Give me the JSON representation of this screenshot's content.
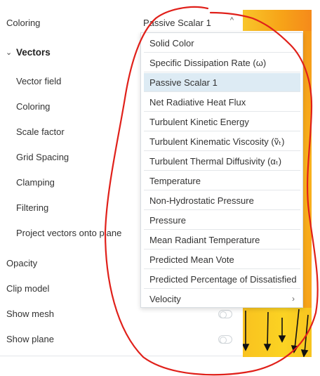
{
  "panel": {
    "coloring_label": "Coloring",
    "coloring_value": "Passive Scalar 1",
    "vectors_title": "Vectors",
    "vector_rows": [
      "Vector field",
      "Coloring",
      "Scale factor",
      "Grid Spacing",
      "Clamping",
      "Filtering",
      "Project vectors onto plane"
    ],
    "bottom_rows": [
      "Opacity",
      "Clip model",
      "Show mesh",
      "Show plane"
    ]
  },
  "dropdown": {
    "items": [
      "Solid Color",
      "Specific Dissipation Rate (ω)",
      "Passive Scalar 1",
      "Net Radiative Heat Flux",
      "Turbulent Kinetic Energy",
      "Turbulent Kinematic Viscosity (ṽₜ)",
      "Turbulent Thermal Diffusivity (αₜ)",
      "Temperature",
      "Non-Hydrostatic Pressure",
      "Pressure",
      "Mean Radiant Temperature",
      "Predicted Mean Vote",
      "Predicted Percentage of Dissatisfied",
      "Velocity"
    ],
    "selected_index": 2,
    "submenu_item": "Velocity"
  },
  "icons": {
    "collapse": "chevron-down-icon",
    "select_caret": "chevron-up-icon",
    "submenu": "chevron-right-icon"
  },
  "colors": {
    "selected_bg": "#ddebf4",
    "annotation": "#e0201a",
    "viz_orange": "#f7a418",
    "viz_yellow": "#fbd323"
  }
}
